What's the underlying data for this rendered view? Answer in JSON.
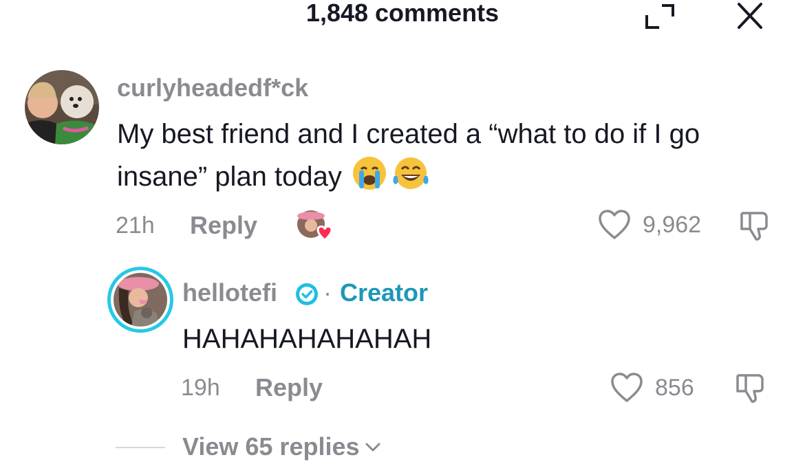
{
  "header": {
    "title": "1,848 comments"
  },
  "icons": {
    "expand": "expand-icon",
    "close": "close-icon",
    "like": "heart-outline-icon",
    "dislike": "thumbs-down-icon",
    "verified": "verified-badge-icon",
    "chevron": "chevron-down-icon"
  },
  "colors": {
    "creator_accent": "#1d97b8",
    "ring": "#25c9e6",
    "verified": "#20bfe0",
    "creator_heart": "#fe2c55"
  },
  "comment": {
    "username": "curlyheadedf*ck",
    "text": "My best friend and I created a “what to do if I go insane” plan today",
    "emojis": [
      "crying-face-emoji",
      "tears-of-joy-emoji"
    ],
    "time": "21h",
    "reply_label": "Reply",
    "likes": "9,962",
    "creator_liked": true
  },
  "reply": {
    "username": "hellotefi",
    "separator": "·",
    "creator_label": "Creator",
    "text": "HAHAHAHAHAHAH",
    "time": "19h",
    "reply_label": "Reply",
    "likes": "856"
  },
  "view_replies": {
    "label": "View 65 replies"
  }
}
